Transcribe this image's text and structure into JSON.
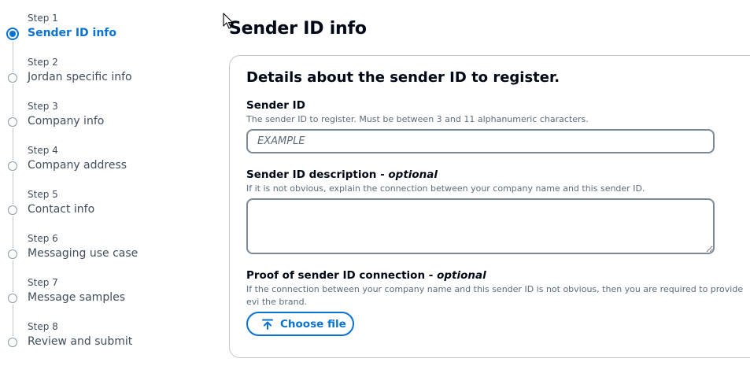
{
  "steps": [
    {
      "num": "Step 1",
      "title": "Sender ID info",
      "active": true
    },
    {
      "num": "Step 2",
      "title": "Jordan specific info"
    },
    {
      "num": "Step 3",
      "title": "Company info"
    },
    {
      "num": "Step 4",
      "title": "Company address"
    },
    {
      "num": "Step 5",
      "title": "Contact info"
    },
    {
      "num": "Step 6",
      "title": "Messaging use case"
    },
    {
      "num": "Step 7",
      "title": "Message samples"
    },
    {
      "num": "Step 8",
      "title": "Review and submit"
    }
  ],
  "page": {
    "title": "Sender ID info"
  },
  "panel": {
    "title": "Details about the sender ID to register.",
    "sender_id": {
      "label": "Sender ID",
      "description": "The sender ID to register. Must be between 3 and 11 alphanumeric characters.",
      "placeholder": "EXAMPLE",
      "value": ""
    },
    "description_field": {
      "label": "Sender ID description - ",
      "optional": "optional",
      "description": "If it is not obvious, explain the connection between your company name and this sender ID.",
      "value": ""
    },
    "proof": {
      "label": "Proof of sender ID connection - ",
      "optional": "optional",
      "description": "If the connection between your company name and this sender ID is not obvious, then you are required to provide evi the brand.",
      "button_label": "Choose file"
    }
  },
  "colors": {
    "accent": "#0972d3",
    "text": "#000716",
    "muted": "#5f6b7a",
    "border": "#7d8998"
  },
  "icons": {
    "active_step": "radio-filled-icon",
    "step": "radio-empty-icon",
    "upload": "upload-arrow-icon",
    "cursor": "mouse-pointer-icon"
  }
}
